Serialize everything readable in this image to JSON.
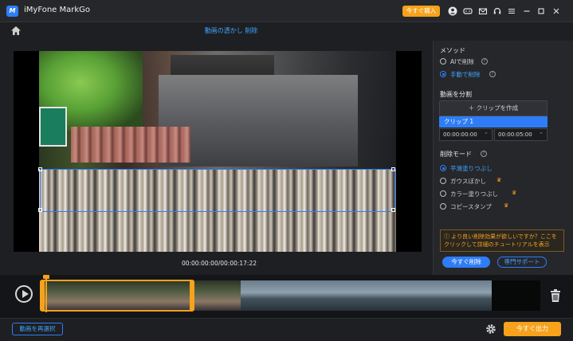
{
  "app": {
    "title": "iMyFone MarkGo",
    "logo_text": "M"
  },
  "titlebar": {
    "buy_label": "今すぐ購入"
  },
  "header": {
    "page_title": "動画の透かし 削除"
  },
  "player": {
    "timecode": "00:00:00:00/00:00:17:22"
  },
  "panel": {
    "method_title": "メソッド",
    "methods": [
      {
        "label": "AIで削除",
        "selected": false
      },
      {
        "label": "手動で削除",
        "selected": true
      }
    ],
    "split_title": "動画を分割",
    "add_clip_label": "＋ クリップを作成",
    "clip_label": "クリップ 1",
    "start_time": "00:00:00:00",
    "end_time": "00:00:05:00",
    "mode_title": "削除モード",
    "modes": [
      {
        "label": "平滑塗りつぶし",
        "selected": true,
        "premium": false
      },
      {
        "label": "ガウスぼかし",
        "selected": false,
        "premium": true
      },
      {
        "label": "カラー塗りつぶし",
        "selected": false,
        "premium": true
      },
      {
        "label": "コピースタンプ",
        "selected": false,
        "premium": true
      }
    ],
    "tip_text": "より良い削除効果が欲しいですか？ここをクリックして詳細のチュートリアルを表示",
    "remove_now_label": "今すぐ削除",
    "support_label": "専門サポート"
  },
  "footer": {
    "reselect_label": "動画を再選択",
    "export_label": "今すぐ出力"
  }
}
